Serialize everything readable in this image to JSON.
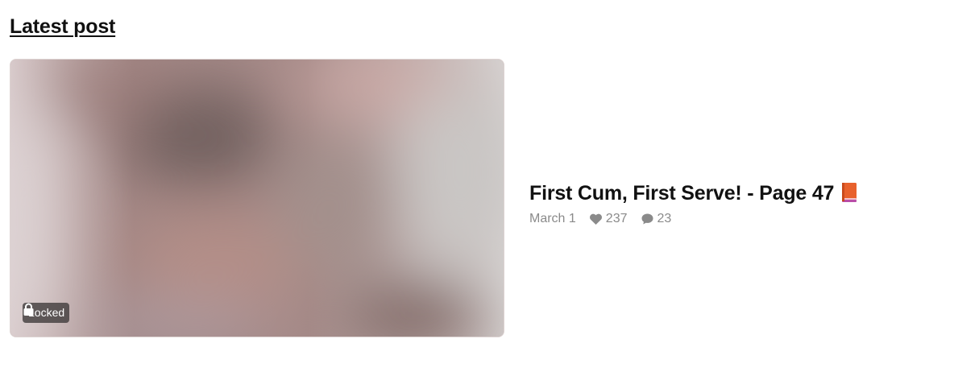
{
  "section": {
    "title": "Latest post"
  },
  "post": {
    "badge_label": "Locked",
    "badge_icon": "lock-icon",
    "title": "First Cum, First Serve! - Page 47",
    "title_emoji_icon": "orange-book-icon",
    "date": "March 1",
    "likes": "237",
    "comments": "23",
    "like_icon": "heart-icon",
    "comment_icon": "comment-bubble-icon"
  },
  "colors": {
    "text": "#111111",
    "meta": "#8a8a8a",
    "badge_bg": "#3c3838"
  }
}
